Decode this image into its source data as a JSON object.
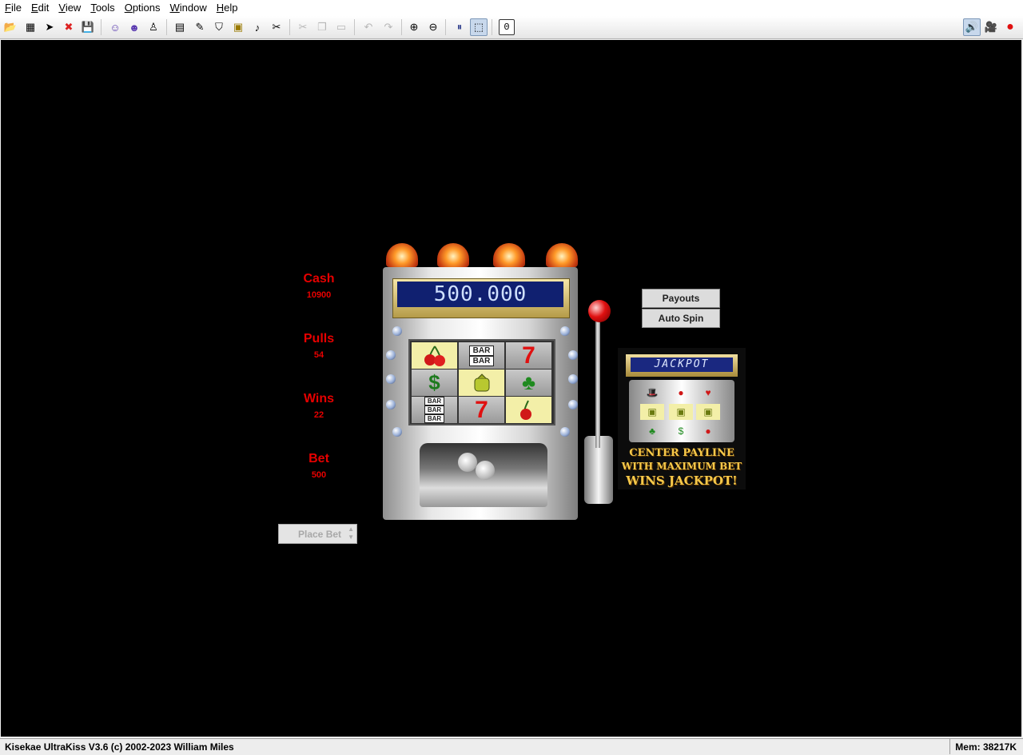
{
  "menu": [
    "File",
    "Edit",
    "View",
    "Tools",
    "Options",
    "Window",
    "Help"
  ],
  "toolbar": {
    "buttons": [
      {
        "name": "open-icon",
        "glyph": "📂"
      },
      {
        "name": "open-recent-icon",
        "glyph": "▦"
      },
      {
        "name": "pointer-icon",
        "glyph": "➤"
      },
      {
        "name": "close-icon",
        "glyph": "✖"
      },
      {
        "name": "save-icon",
        "glyph": "💾"
      },
      {
        "name": "character-icon",
        "glyph": "☺"
      },
      {
        "name": "character-alt-icon",
        "glyph": "☻"
      },
      {
        "name": "penguin-icon",
        "glyph": "♙"
      },
      {
        "name": "notes-icon",
        "glyph": "▤"
      },
      {
        "name": "pencil-icon",
        "glyph": "✎"
      },
      {
        "name": "shirt-icon",
        "glyph": "⛉"
      },
      {
        "name": "page-edit-icon",
        "glyph": "▣"
      },
      {
        "name": "music-icon",
        "glyph": "♪"
      },
      {
        "name": "tools-icon",
        "glyph": "✂"
      },
      {
        "name": "cut-icon",
        "glyph": "✂"
      },
      {
        "name": "copy-icon",
        "glyph": "❐"
      },
      {
        "name": "paste-icon",
        "glyph": "▭"
      },
      {
        "name": "undo-icon",
        "glyph": "↶"
      },
      {
        "name": "redo-icon",
        "glyph": "↷"
      },
      {
        "name": "zoom-in-icon",
        "glyph": "⊕"
      },
      {
        "name": "zoom-out-icon",
        "glyph": "⊖"
      },
      {
        "name": "pause-icon",
        "glyph": "⏸"
      },
      {
        "name": "select-icon",
        "glyph": "⬚"
      }
    ],
    "counter": "0",
    "right": [
      {
        "name": "speaker-icon",
        "glyph": "🔊"
      },
      {
        "name": "camera-icon",
        "glyph": "🎥"
      },
      {
        "name": "record-icon",
        "glyph": "●"
      }
    ]
  },
  "stats": {
    "cash_label": "Cash",
    "cash_value": "10900",
    "pulls_label": "Pulls",
    "pulls_value": "54",
    "wins_label": "Wins",
    "wins_value": "22",
    "bet_label": "Bet",
    "bet_value": "500"
  },
  "machine": {
    "display": "500.000",
    "reels": [
      [
        "cherry-icon",
        "bar-icon",
        "seven-icon"
      ],
      [
        "dollar-icon",
        "money-bag-icon",
        "clover-icon"
      ],
      [
        "triple-bar-icon",
        "seven-icon",
        "cherry-icon"
      ]
    ],
    "reel_labels": {
      "bar": "BAR",
      "seven": "7"
    }
  },
  "buttons": {
    "payouts": "Payouts",
    "auto_spin": "Auto Spin",
    "place_bet": "Place Bet"
  },
  "jackpot": {
    "display": "JACKPOT",
    "caption_line1": "CENTER PAYLINE",
    "caption_line2": "WITH MAXIMUM BET",
    "caption_line3": "WINS JACKPOT!"
  },
  "status": {
    "text": "Kisekae UltraKiss V3.6 (c) 2002-2023 William Miles",
    "memory": "Mem: 38217K"
  }
}
